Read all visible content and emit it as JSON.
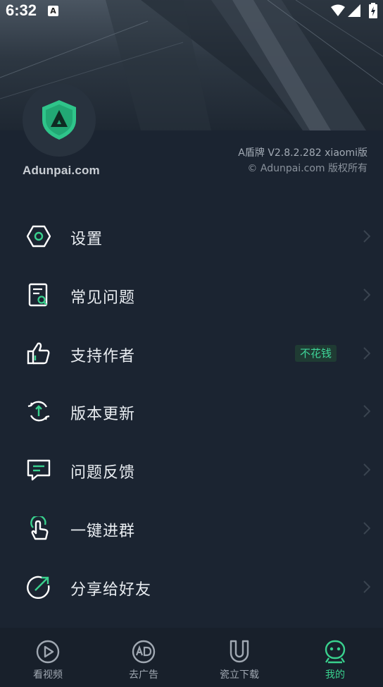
{
  "status_bar": {
    "time": "6:32",
    "notification_icon": "A"
  },
  "header": {
    "brand": "Adunpai.com",
    "version": "A盾牌 V2.8.2.282 xiaomi版",
    "copyright": "© Adunpai.com 版权所有"
  },
  "menu": {
    "items": [
      {
        "label": "设置",
        "icon": "settings-hexagon-icon"
      },
      {
        "label": "常见问题",
        "icon": "faq-document-icon"
      },
      {
        "label": "支持作者",
        "icon": "thumbs-up-icon",
        "badge": "不花钱"
      },
      {
        "label": "版本更新",
        "icon": "update-refresh-icon"
      },
      {
        "label": "问题反馈",
        "icon": "feedback-chat-icon"
      },
      {
        "label": "一键进群",
        "icon": "tap-hand-icon"
      },
      {
        "label": "分享给好友",
        "icon": "share-arrow-icon"
      }
    ]
  },
  "tabbar": {
    "tabs": [
      {
        "label": "看视频",
        "icon": "play-video-icon"
      },
      {
        "label": "去广告",
        "icon": "ad-block-icon"
      },
      {
        "label": "瓷立下载",
        "icon": "magnet-icon"
      },
      {
        "label": "我的",
        "icon": "profile-face-icon",
        "active": true
      }
    ]
  },
  "colors": {
    "background": "#1b2431",
    "accent": "#39d18e",
    "badge_bg": "#1f3b33",
    "tabbar_bg": "#18202b"
  }
}
